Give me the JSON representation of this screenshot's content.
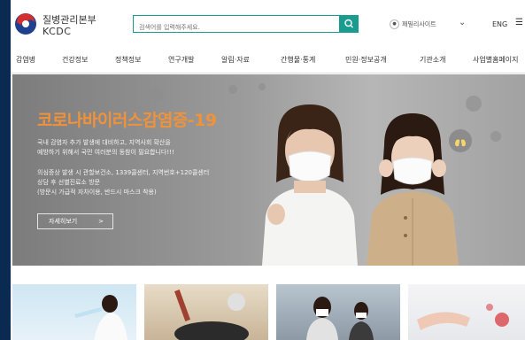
{
  "header": {
    "org_name_kr": "질병관리본부",
    "org_name_en": "KCDC",
    "search_placeholder": "검색어를 입력해주세요.",
    "lang_label": "패밀리사이트",
    "lang_icon": "globe-icon",
    "eng_label": "ENG"
  },
  "nav": {
    "items": [
      "감염병",
      "건강정보",
      "정책정보",
      "연구개발",
      "알림·자료",
      "간행물·통계",
      "민원·정보공개",
      "기관소개",
      "사업별홈페이지"
    ]
  },
  "banner": {
    "title": "코로나바이러스감염증-19",
    "line1": "국내 감염자 추가 발생에 대비하고, 지역사회 확산을",
    "line2": "예방하기 위해서 국민 여러분의 동참이 필요합니다!!!",
    "line3": "의심증상 발생 시 관할보건소, 1339콜센터, 지역번호+120콜센터",
    "line4": "상담 후 선별진료소 방문",
    "line5": "(방문시 가급적 자차이용, 반드시 마스크 착용)",
    "more_label": "자세히보기",
    "more_arrow": ">"
  },
  "colors": {
    "brand": "#1a9b8f",
    "title": "#f0923a",
    "outer_bg": "#0b2a52"
  }
}
